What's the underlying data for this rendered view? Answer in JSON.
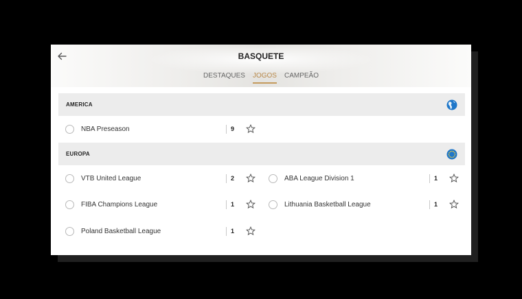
{
  "header": {
    "title": "BASQUETE",
    "tabs": [
      {
        "label": "DESTAQUES",
        "active": false
      },
      {
        "label": "JOGOS",
        "active": true
      },
      {
        "label": "CAMPEÃO",
        "active": false
      }
    ]
  },
  "sections": [
    {
      "title": "AMERICA",
      "icon": "globe-americas-icon",
      "leagues": [
        {
          "name": "NBA Preseason",
          "count": "9"
        }
      ]
    },
    {
      "title": "EUROPA",
      "icon": "europe-flag-icon",
      "leagues": [
        {
          "name": "VTB United League",
          "count": "2"
        },
        {
          "name": "ABA League Division 1",
          "count": "1"
        },
        {
          "name": "FIBA Champions League",
          "count": "1"
        },
        {
          "name": "Lithuania Basketball League",
          "count": "1"
        },
        {
          "name": "Poland Basketball League",
          "count": "1"
        }
      ]
    }
  ],
  "colors": {
    "accent": "#c49a5c",
    "section_bg": "#ececec",
    "globe_blue": "#1f77c9"
  }
}
